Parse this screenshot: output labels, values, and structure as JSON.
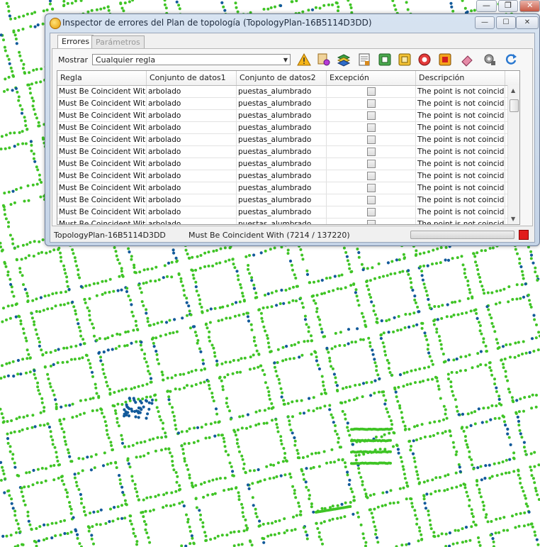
{
  "window": {
    "title": "Inspector de errores del Plan de topología (TopologyPlan-16B5114D3DD)",
    "buttons": {
      "minimize": "—",
      "maximize": "☐",
      "close": "✕"
    }
  },
  "host_controls": {
    "minimize": "—",
    "restore": "❐",
    "close": "✕"
  },
  "tabs": [
    {
      "label": "Errores",
      "active": true
    },
    {
      "label": "Parámetros",
      "active": false
    }
  ],
  "filter": {
    "label": "Mostrar",
    "value": "Cualquier regla"
  },
  "toolbar": [
    {
      "icon": "warning-icon"
    },
    {
      "icon": "error-zoom-icon"
    },
    {
      "icon": "layers-icon"
    },
    {
      "icon": "report-icon"
    },
    {
      "icon": "zoom-extent-icon"
    },
    {
      "icon": "zoom-selection-icon"
    },
    {
      "icon": "flash-error-icon"
    },
    {
      "icon": "stop-record-icon"
    },
    {
      "icon": "eraser-icon"
    },
    {
      "icon": "settings-icon"
    },
    {
      "icon": "refresh-icon"
    }
  ],
  "table": {
    "columns": [
      "Regla",
      "Conjunto de datos1",
      "Conjunto de datos2",
      "Excepción",
      "Descripción"
    ],
    "rows": [
      {
        "rule": "Must Be Coincident With",
        "ds1": "arbolado",
        "ds2": "puestas_alumbrado",
        "exception": false,
        "desc": "The point is not coincid..."
      },
      {
        "rule": "Must Be Coincident With",
        "ds1": "arbolado",
        "ds2": "puestas_alumbrado",
        "exception": false,
        "desc": "The point is not coincid..."
      },
      {
        "rule": "Must Be Coincident With",
        "ds1": "arbolado",
        "ds2": "puestas_alumbrado",
        "exception": false,
        "desc": "The point is not coincid..."
      },
      {
        "rule": "Must Be Coincident With",
        "ds1": "arbolado",
        "ds2": "puestas_alumbrado",
        "exception": false,
        "desc": "The point is not coincid..."
      },
      {
        "rule": "Must Be Coincident With",
        "ds1": "arbolado",
        "ds2": "puestas_alumbrado",
        "exception": false,
        "desc": "The point is not coincid..."
      },
      {
        "rule": "Must Be Coincident With",
        "ds1": "arbolado",
        "ds2": "puestas_alumbrado",
        "exception": false,
        "desc": "The point is not coincid..."
      },
      {
        "rule": "Must Be Coincident With",
        "ds1": "arbolado",
        "ds2": "puestas_alumbrado",
        "exception": false,
        "desc": "The point is not coincid..."
      },
      {
        "rule": "Must Be Coincident With",
        "ds1": "arbolado",
        "ds2": "puestas_alumbrado",
        "exception": false,
        "desc": "The point is not coincid..."
      },
      {
        "rule": "Must Be Coincident With",
        "ds1": "arbolado",
        "ds2": "puestas_alumbrado",
        "exception": false,
        "desc": "The point is not coincid..."
      },
      {
        "rule": "Must Be Coincident With",
        "ds1": "arbolado",
        "ds2": "puestas_alumbrado",
        "exception": false,
        "desc": "The point is not coincid..."
      },
      {
        "rule": "Must Be Coincident With",
        "ds1": "arbolado",
        "ds2": "puestas_alumbrado",
        "exception": false,
        "desc": "The point is not coincid..."
      },
      {
        "rule": "Must Be Coincident With",
        "ds1": "arbolado",
        "ds2": "puestas_alumbrado",
        "exception": false,
        "desc": "The point is not coincid..."
      }
    ],
    "scroll_up": "▲",
    "scroll_down": "▼"
  },
  "status": {
    "plan": "TopologyPlan-16B5114D3DD",
    "message": "Must Be Coincident With (7214 / 137220)",
    "progress": 0
  },
  "colors": {
    "tree_points": "#3fc425",
    "lamp_points": "#125a9a",
    "dialog_frame": "#c4d3e6",
    "stop_button": "#e11d1d"
  }
}
